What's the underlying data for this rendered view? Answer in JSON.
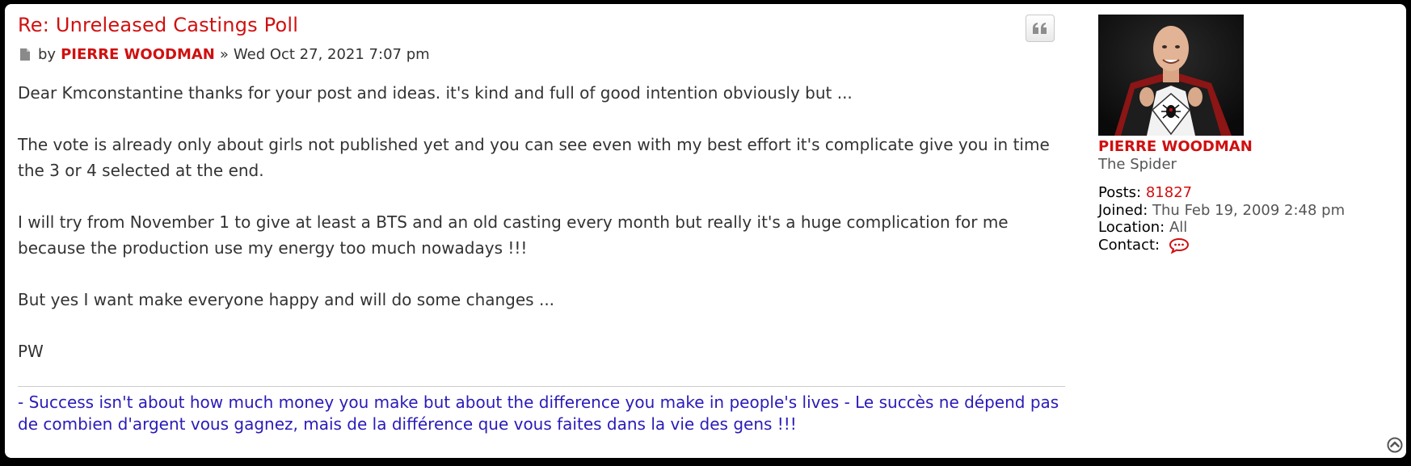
{
  "post": {
    "title": "Re: Unreleased Castings Poll",
    "by_label": "by",
    "author": "PIERRE WOODMAN",
    "separator": "»",
    "date": "Wed Oct 27, 2021 7:07 pm",
    "paragraphs": [
      "Dear Kmconstantine thanks for your post and ideas. it's kind and full of good intention obviously but ...",
      "The vote is already only about girls not published yet and you can see even with my best effort it's complicate give you in time the 3 or 4 selected at the end.",
      "I will try from November 1 to give at least a BTS and an old casting every month but really it's a huge complication for me because the production use my energy too much nowadays !!!",
      "But yes I want make everyone happy and will do some changes ...",
      "PW"
    ],
    "signature": "- Success isn't about how much money you make but about the difference you make in people's lives - Le succès ne dépend pas de combien d'argent vous gagnez, mais de la différence que vous faites dans la vie des gens !!!",
    "quote_icon": "quote-icon",
    "post_icon": "file-icon"
  },
  "profile": {
    "name": "PIERRE WOODMAN",
    "rank": "The Spider",
    "posts_label": "Posts:",
    "posts_value": "81827",
    "joined_label": "Joined:",
    "joined_value": "Thu Feb 19, 2009 2:48 pm",
    "location_label": "Location:",
    "location_value": "All",
    "contact_label": "Contact:",
    "contact_icon": "speech-bubble-icon"
  },
  "colors": {
    "accent": "#d01010",
    "signature": "#2a1bb8",
    "text": "#333333"
  },
  "back_to_top_icon": "arrow-up-circle-icon"
}
